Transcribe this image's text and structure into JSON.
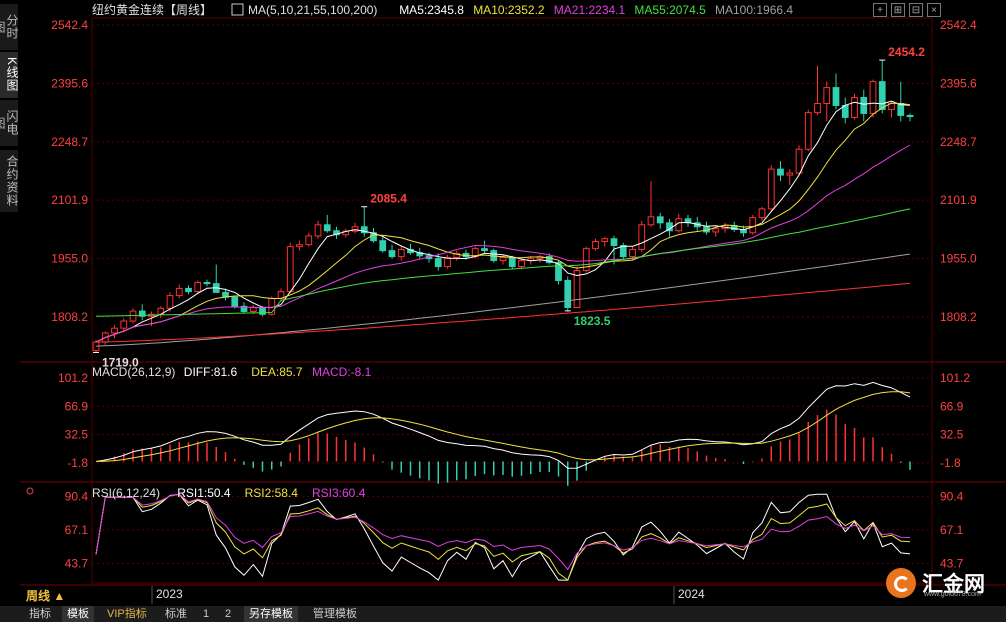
{
  "title": "纽约黄金连续【周线】",
  "side_tabs": [
    "分时图",
    "K线图",
    "闪电图",
    "合约资料"
  ],
  "ma_header": {
    "label": "MA(5,10,21,55,100,200)",
    "items": [
      {
        "text": "MA5:2345.8",
        "color": "#ffffff"
      },
      {
        "text": "MA10:2352.2",
        "color": "#f0e040"
      },
      {
        "text": "MA21:2234.1",
        "color": "#e040e0"
      },
      {
        "text": "MA55:2074.5",
        "color": "#40e040"
      },
      {
        "text": "MA100:1966.4",
        "color": "#a0a0a0"
      }
    ]
  },
  "macd_header": {
    "label": "MACD(26,12,9)",
    "items": [
      {
        "text": "DIFF:81.6",
        "color": "#ffffff"
      },
      {
        "text": "DEA:85.7",
        "color": "#f0e040"
      },
      {
        "text": "MACD:-8.1",
        "color": "#e040e0"
      }
    ]
  },
  "rsi_header": {
    "label": "RSI(6,12,24)",
    "items": [
      {
        "text": "RSI1:50.4",
        "color": "#ffffff"
      },
      {
        "text": "RSI2:58.4",
        "color": "#f0e040"
      },
      {
        "text": "RSI3:60.4",
        "color": "#e040e0"
      }
    ]
  },
  "price_axis": [
    "2542.4",
    "2395.6",
    "2248.7",
    "2101.9",
    "1955.0",
    "1808.2"
  ],
  "macd_axis": [
    "101.2",
    "66.9",
    "32.5",
    "-1.8"
  ],
  "rsi_axis": [
    "90.4",
    "67.1",
    "43.7"
  ],
  "annotations": {
    "high": "2454.2",
    "mid_high": "2085.4",
    "low1": "1823.5",
    "low0": "1719.0"
  },
  "x_labels": [
    "2023",
    "2024"
  ],
  "period_label": "周线 ▲",
  "bottom_tabs": [
    "指标",
    "模板",
    "VIP指标",
    "标准",
    "1",
    "2",
    "另存模板",
    "管理模板"
  ],
  "logo": {
    "name": "汇金网",
    "url": "www.gold678.com"
  },
  "colors": {
    "up": "#ff3030",
    "down": "#30d0b0",
    "grid": "#5a0000",
    "axis_text": "#ff4040",
    "annot_up": "#ff4040",
    "annot_down": "#30d070"
  },
  "chart_data": {
    "type": "candlestick",
    "title": "纽约黄金连续【周线】",
    "price_range": [
      1700,
      2560
    ],
    "candles": [
      [
        1724.0,
        1750.5,
        1719.0,
        1745.0
      ],
      [
        1745.0,
        1772.0,
        1738.0,
        1768.0
      ],
      [
        1768.0,
        1788.0,
        1754.0,
        1780.0
      ],
      [
        1780.0,
        1805.0,
        1770.0,
        1798.0
      ],
      [
        1798.0,
        1830.0,
        1792.0,
        1823.0
      ],
      [
        1823.0,
        1840.0,
        1800.0,
        1810.0
      ],
      [
        1810.0,
        1822.0,
        1785.0,
        1815.0
      ],
      [
        1815.0,
        1835.0,
        1805.0,
        1830.0
      ],
      [
        1830.0,
        1870.0,
        1822.0,
        1862.0
      ],
      [
        1862.0,
        1890.0,
        1855.0,
        1880.0
      ],
      [
        1880.0,
        1888.0,
        1865.0,
        1872.0
      ],
      [
        1872.0,
        1900.0,
        1868.0,
        1895.0
      ],
      [
        1895.0,
        1902.0,
        1885.0,
        1892.0
      ],
      [
        1892.0,
        1940.0,
        1888.0,
        1870.0
      ],
      [
        1870.0,
        1880.0,
        1850.0,
        1858.0
      ],
      [
        1858.0,
        1862.0,
        1830.0,
        1835.0
      ],
      [
        1835.0,
        1845.0,
        1818.0,
        1822.0
      ],
      [
        1822.0,
        1838.0,
        1815.0,
        1832.0
      ],
      [
        1832.0,
        1835.0,
        1810.0,
        1815.0
      ],
      [
        1815.0,
        1860.0,
        1812.0,
        1855.0
      ],
      [
        1855.0,
        1880.0,
        1850.0,
        1872.0
      ],
      [
        1872.0,
        1995.0,
        1868.0,
        1985.0
      ],
      [
        1985.0,
        2000.0,
        1975.0,
        1990.0
      ],
      [
        1990.0,
        2020.0,
        1985.0,
        2012.0
      ],
      [
        2012.0,
        2050.0,
        2005.0,
        2040.0
      ],
      [
        2040.0,
        2065.0,
        2020.0,
        2025.0
      ],
      [
        2025.0,
        2035.0,
        2005.0,
        2015.0
      ],
      [
        2015.0,
        2030.0,
        2008.0,
        2024.0
      ],
      [
        2024.0,
        2045.0,
        2018.0,
        2035.0
      ],
      [
        2035.0,
        2085.4,
        2010.0,
        2020.0
      ],
      [
        2020.0,
        2032.0,
        1995.0,
        2000.0
      ],
      [
        2000.0,
        2012.0,
        1970.0,
        1975.0
      ],
      [
        1975.0,
        1990.0,
        1955.0,
        1960.0
      ],
      [
        1960.0,
        1985.0,
        1950.0,
        1978.0
      ],
      [
        1978.0,
        1992.0,
        1965.0,
        1970.0
      ],
      [
        1970.0,
        1982.0,
        1955.0,
        1962.0
      ],
      [
        1962.0,
        1970.0,
        1945.0,
        1955.0
      ],
      [
        1955.0,
        1968.0,
        1925.0,
        1935.0
      ],
      [
        1935.0,
        1965.0,
        1930.0,
        1958.0
      ],
      [
        1958.0,
        1975.0,
        1950.0,
        1968.0
      ],
      [
        1968.0,
        1978.0,
        1952.0,
        1960.0
      ],
      [
        1960.0,
        1985.0,
        1955.0,
        1980.0
      ],
      [
        1980.0,
        2000.0,
        1970.0,
        1975.0
      ],
      [
        1975.0,
        1980.0,
        1945.0,
        1950.0
      ],
      [
        1950.0,
        1965.0,
        1940.0,
        1958.0
      ],
      [
        1958.0,
        1962.0,
        1930.0,
        1935.0
      ],
      [
        1935.0,
        1955.0,
        1928.0,
        1950.0
      ],
      [
        1950.0,
        1962.0,
        1940.0,
        1955.0
      ],
      [
        1955.0,
        1965.0,
        1945.0,
        1960.0
      ],
      [
        1960.0,
        1968.0,
        1940.0,
        1945.0
      ],
      [
        1945.0,
        1950.0,
        1890.0,
        1900.0
      ],
      [
        1900.0,
        1910.0,
        1823.5,
        1832.0
      ],
      [
        1832.0,
        1935.0,
        1830.0,
        1925.0
      ],
      [
        1925.0,
        1985.0,
        1920.0,
        1980.0
      ],
      [
        1980.0,
        2005.0,
        1975.0,
        1998.0
      ],
      [
        1998.0,
        2010.0,
        1985.0,
        2005.0
      ],
      [
        2005.0,
        2012.0,
        1940.0,
        1988.0
      ],
      [
        1988.0,
        1995.0,
        1955.0,
        1960.0
      ],
      [
        1960.0,
        1985.0,
        1952.0,
        1978.0
      ],
      [
        1978.0,
        2050.0,
        1972.0,
        2040.0
      ],
      [
        2040.0,
        2150.0,
        2035.0,
        2060.0
      ],
      [
        2060.0,
        2070.0,
        2030.0,
        2045.0
      ],
      [
        2045.0,
        2055.0,
        2010.0,
        2025.0
      ],
      [
        2025.0,
        2068.0,
        2020.0,
        2055.0
      ],
      [
        2055.0,
        2065.0,
        2035.0,
        2045.0
      ],
      [
        2045.0,
        2060.0,
        2025.0,
        2035.0
      ],
      [
        2035.0,
        2048.0,
        2015.0,
        2022.0
      ],
      [
        2022.0,
        2035.0,
        2010.0,
        2030.0
      ],
      [
        2030.0,
        2045.0,
        2020.0,
        2038.0
      ],
      [
        2038.0,
        2048.0,
        2022.0,
        2028.0
      ],
      [
        2028.0,
        2038.0,
        2010.0,
        2020.0
      ],
      [
        2020.0,
        2065.0,
        2015.0,
        2058.0
      ],
      [
        2058.0,
        2085.0,
        2050.0,
        2080.0
      ],
      [
        2080.0,
        2190.0,
        2075.0,
        2180.0
      ],
      [
        2180.0,
        2200.0,
        2150.0,
        2165.0
      ],
      [
        2165.0,
        2180.0,
        2140.0,
        2170.0
      ],
      [
        2170.0,
        2240.0,
        2165.0,
        2230.0
      ],
      [
        2230.0,
        2330.0,
        2225.0,
        2322.0
      ],
      [
        2322.0,
        2440.0,
        2315.0,
        2345.0
      ],
      [
        2345.0,
        2400.0,
        2300.0,
        2385.0
      ],
      [
        2385.0,
        2420.0,
        2330.0,
        2340.0
      ],
      [
        2340.0,
        2360.0,
        2295.0,
        2310.0
      ],
      [
        2310.0,
        2370.0,
        2305.0,
        2360.0
      ],
      [
        2360.0,
        2380.0,
        2300.0,
        2320.0
      ],
      [
        2320.0,
        2405.0,
        2310.0,
        2400.0
      ],
      [
        2400.0,
        2454.2,
        2320.0,
        2330.0
      ],
      [
        2330.0,
        2350.0,
        2310.0,
        2345.0
      ],
      [
        2345.0,
        2400.0,
        2300.0,
        2315.0
      ],
      [
        2315.0,
        2320.0,
        2300.0,
        2312.0
      ]
    ],
    "macd_hist_range": [
      -20,
      101.2
    ],
    "rsi_range": [
      30,
      95
    ]
  }
}
